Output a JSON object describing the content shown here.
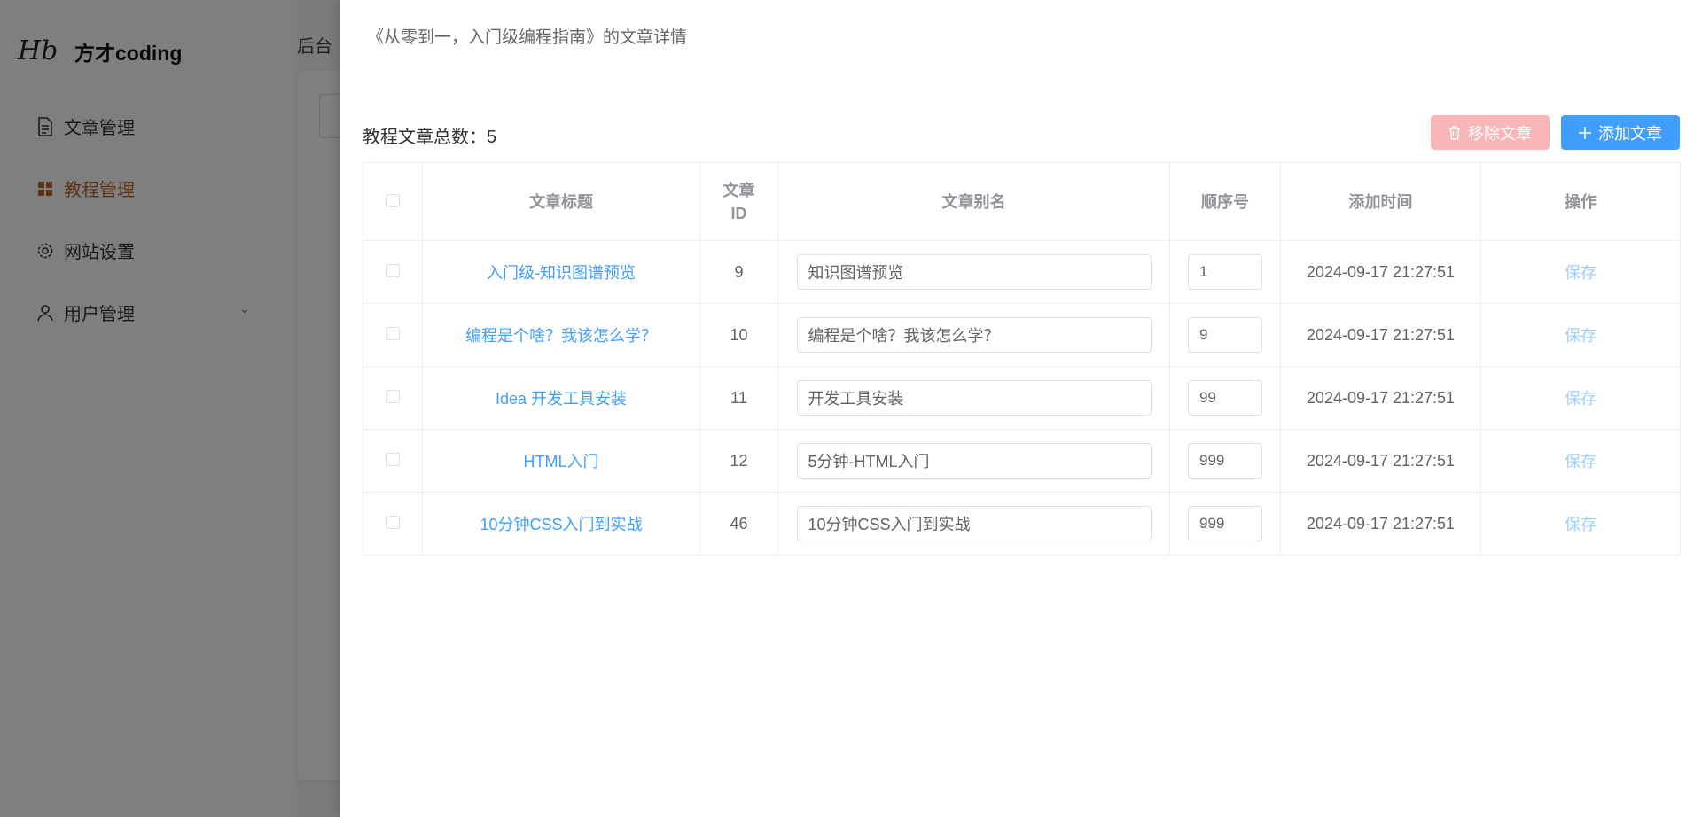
{
  "app": {
    "brand": "方才coding",
    "logo_mark": "Hb",
    "header_text": "后台"
  },
  "sidebar": {
    "items": [
      {
        "label": "文章管理",
        "icon": "document-icon"
      },
      {
        "label": "教程管理",
        "icon": "grid-icon",
        "active": true
      },
      {
        "label": "网站设置",
        "icon": "gear-icon"
      },
      {
        "label": "用户管理",
        "icon": "user-icon",
        "has_submenu": true
      }
    ]
  },
  "drawer": {
    "title": "《从零到一，入门级编程指南》的文章详情",
    "count_label": "教程文章总数：",
    "count_value": "5",
    "remove_button": "移除文章",
    "add_button": "添加文章",
    "columns": [
      "文章标题",
      "文章\nID",
      "文章别名",
      "顺序号",
      "添加时间",
      "操作"
    ],
    "rows": [
      {
        "title": "入门级-知识图谱预览",
        "id": "9",
        "alias": "知识图谱预览",
        "order": "1",
        "time": "2024-09-17 21:27:51",
        "action": "保存"
      },
      {
        "title": "编程是个啥？我该怎么学？",
        "id": "10",
        "alias": "编程是个啥？我该怎么学？",
        "order": "9",
        "time": "2024-09-17 21:27:51",
        "action": "保存"
      },
      {
        "title": "Idea 开发工具安装",
        "id": "11",
        "alias": "开发工具安装",
        "order": "99",
        "time": "2024-09-17 21:27:51",
        "action": "保存"
      },
      {
        "title": "HTML入门",
        "id": "12",
        "alias": "5分钟-HTML入门",
        "order": "999",
        "time": "2024-09-17 21:27:51",
        "action": "保存"
      },
      {
        "title": "10分钟CSS入门到实战",
        "id": "46",
        "alias": "10分钟CSS入门到实战",
        "order": "999",
        "time": "2024-09-17 21:27:51",
        "action": "保存"
      }
    ]
  },
  "colors": {
    "primary": "#409eff",
    "danger_disabled": "#fab6b6",
    "active_menu": "#b8652a",
    "overlay": "rgba(0,0,0,0.5)"
  }
}
